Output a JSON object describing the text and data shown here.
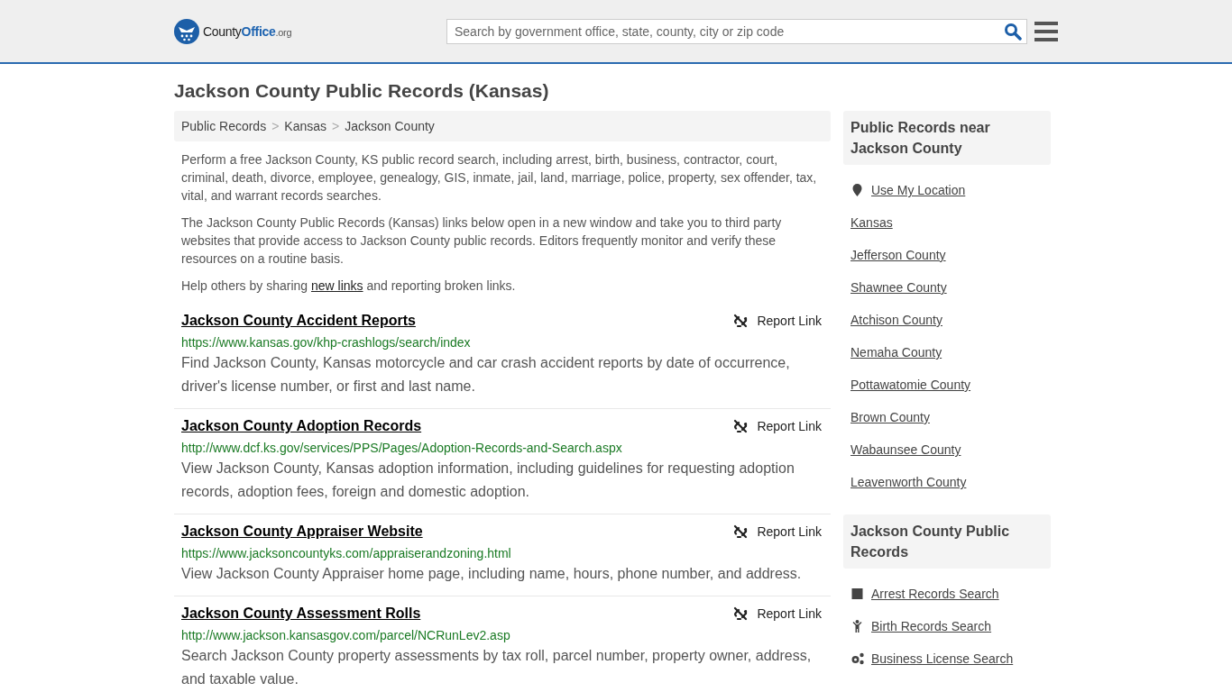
{
  "header": {
    "logo_text": [
      "County",
      "Office",
      ".org"
    ],
    "search": {
      "placeholder": "Search by government office, state, county, city or zip code"
    }
  },
  "title": "Jackson County Public Records (Kansas)",
  "breadcrumbs": [
    "Public Records",
    "Kansas",
    "Jackson County"
  ],
  "breadcrumb_separator": ">",
  "intro": [
    "Perform a free Jackson County, KS public record search, including arrest, birth, business, contractor, court, criminal, death, divorce, employee, genealogy, GIS, inmate, jail, land, marriage, police, property, sex offender, tax, vital, and warrant records searches.",
    "The Jackson County Public Records (Kansas) links below open in a new window and take you to third party websites that provide access to Jackson County public records. Editors frequently monitor and verify these resources on a routine basis."
  ],
  "help": {
    "before": "Help others by sharing ",
    "link": "new links",
    "after": " and reporting broken links."
  },
  "results": [
    {
      "title": "Jackson County Accident Reports",
      "report": "Report Link",
      "url": "https://www.kansas.gov/khp-crashlogs/search/index",
      "description": "Find Jackson County, Kansas motorcycle and car crash accident reports by date of occurrence, driver's license number, or first and last name."
    },
    {
      "title": "Jackson County Adoption Records",
      "report": "Report Link",
      "url": "http://www.dcf.ks.gov/services/PPS/Pages/Adoption-Records-and-Search.aspx",
      "description": "View Jackson County, Kansas adoption information, including guidelines for requesting adoption records, adoption fees, foreign and domestic adoption."
    },
    {
      "title": "Jackson County Appraiser Website",
      "report": "Report Link",
      "url": "https://www.jacksoncountyks.com/appraiserandzoning.html",
      "description": "View Jackson County Appraiser home page, including name, hours, phone number, and address."
    },
    {
      "title": "Jackson County Assessment Rolls",
      "report": "Report Link",
      "url": "http://www.jackson.kansasgov.com/parcel/NCRunLev2.asp",
      "description": "Search Jackson County property assessments by tax roll, parcel number, property owner, address, and taxable value."
    }
  ],
  "sidebar": [
    {
      "heading": "Public Records near Jackson County",
      "items": [
        {
          "label": "Use My Location",
          "kind": "pin"
        },
        {
          "label": "Kansas",
          "kind": "plain"
        },
        {
          "label": "Jefferson County",
          "kind": "plain"
        },
        {
          "label": "Shawnee County",
          "kind": "plain"
        },
        {
          "label": "Atchison County",
          "kind": "plain"
        },
        {
          "label": "Nemaha County",
          "kind": "plain"
        },
        {
          "label": "Pottawatomie County",
          "kind": "plain"
        },
        {
          "label": "Brown County",
          "kind": "plain"
        },
        {
          "label": "Wabaunsee County",
          "kind": "plain"
        },
        {
          "label": "Leavenworth County",
          "kind": "plain"
        }
      ]
    },
    {
      "heading": "Jackson County Public Records",
      "items": [
        {
          "label": "Arrest Records Search",
          "kind": "square"
        },
        {
          "label": "Birth Records Search",
          "kind": "child"
        },
        {
          "label": "Business License Search",
          "kind": "gears"
        }
      ]
    }
  ]
}
